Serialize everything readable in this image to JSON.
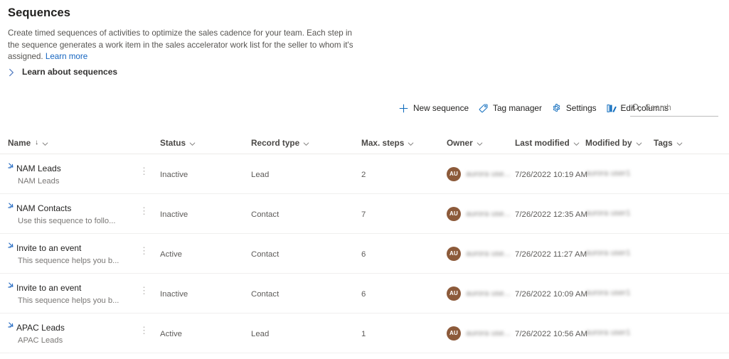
{
  "header": {
    "title": "Sequences",
    "description_line1": "Create timed sequences of activities to optimize the sales cadence for your team. Each step in the sequence",
    "description_line2": "generates a work item in the sales accelerator work list for the seller to whom it's assigned.",
    "learn_more_label": "Learn more",
    "expander_label": "Learn about sequences",
    "expander_icon": "chevron-right-icon"
  },
  "toolbar": {
    "new_sequence_label": "New sequence",
    "new_sequence_icon": "plus-icon",
    "tag_manager_label": "Tag manager",
    "tag_manager_icon": "tag-icon",
    "settings_label": "Settings",
    "settings_icon": "gear-icon",
    "edit_columns_label": "Edit columns",
    "edit_columns_icon": "edit-columns-icon",
    "search_placeholder": "Search",
    "search_value": "",
    "search_icon": "search-icon"
  },
  "colors": {
    "accent": "#0f6cbd",
    "link": "#1565c0",
    "avatar_bg": "#8c5a3a",
    "row_border": "#f0efee"
  },
  "grid": {
    "columns": [
      {
        "label": "Name",
        "sorted": true,
        "sort_glyph": "↓",
        "menu_icon": "chevron-down-icon"
      },
      {
        "label": "Status",
        "sorted": false,
        "menu_icon": "chevron-down-icon"
      },
      {
        "label": "Record type",
        "sorted": false,
        "menu_icon": "chevron-down-icon"
      },
      {
        "label": "Max. steps",
        "sorted": false,
        "menu_icon": "chevron-down-icon"
      },
      {
        "label": "Owner",
        "sorted": false,
        "menu_icon": "chevron-down-icon"
      },
      {
        "label": "Last modified",
        "sorted": false,
        "menu_icon": "chevron-down-icon"
      },
      {
        "label": "Modified by",
        "sorted": false,
        "menu_icon": "chevron-down-icon"
      },
      {
        "label": "Tags",
        "sorted": false,
        "menu_icon": "chevron-down-icon"
      }
    ],
    "row_menu_icon": "more-vertical-icon",
    "row_icon": "sequence-icon",
    "owner_avatar_initials": "AU",
    "rows": [
      {
        "name": "NAM Leads",
        "subtitle": "NAM Leads",
        "status": "Inactive",
        "record_type": "Lead",
        "max_steps": "2",
        "owner": "aurora use...",
        "last_modified": "7/26/2022 10:19 AM",
        "modified_by": "aurora user17",
        "tags": ""
      },
      {
        "name": "NAM Contacts",
        "subtitle": "Use this sequence to follo...",
        "status": "Inactive",
        "record_type": "Contact",
        "max_steps": "7",
        "owner": "aurora use...",
        "last_modified": "7/26/2022 12:35 AM",
        "modified_by": "aurora user17",
        "tags": ""
      },
      {
        "name": "Invite to an event",
        "subtitle": "This sequence helps you b...",
        "status": "Active",
        "record_type": "Contact",
        "max_steps": "6",
        "owner": "aurora use...",
        "last_modified": "7/26/2022 11:27 AM",
        "modified_by": "aurora user17",
        "tags": ""
      },
      {
        "name": "Invite to an event",
        "subtitle": "This sequence helps you b...",
        "status": "Inactive",
        "record_type": "Contact",
        "max_steps": "6",
        "owner": "aurora use...",
        "last_modified": "7/26/2022 10:09 AM",
        "modified_by": "aurora user17",
        "tags": ""
      },
      {
        "name": "APAC Leads",
        "subtitle": "APAC Leads",
        "status": "Active",
        "record_type": "Lead",
        "max_steps": "1",
        "owner": "aurora use...",
        "last_modified": "7/26/2022 10:56 AM",
        "modified_by": "aurora user17",
        "tags": ""
      }
    ]
  }
}
